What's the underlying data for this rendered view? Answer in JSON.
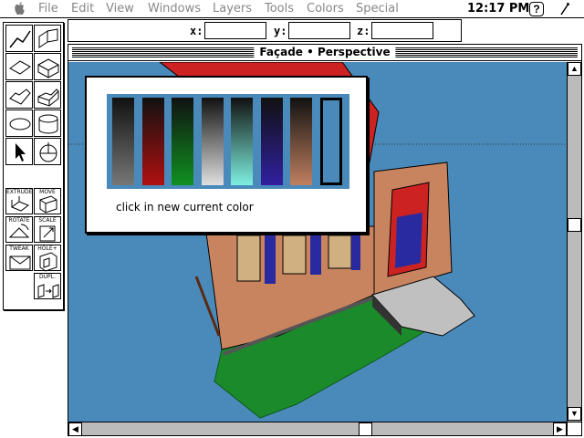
{
  "menubar": {
    "items": [
      "File",
      "Edit",
      "View",
      "Windows",
      "Layers",
      "Tools",
      "Colors",
      "Special"
    ],
    "clock": "12:17 PM",
    "help": "?"
  },
  "coordbar": {
    "x_label": "x:",
    "y_label": "y:",
    "z_label": "z:",
    "x_value": "",
    "y_value": "",
    "z_value": ""
  },
  "palette": {
    "labels": {
      "extrude": "EXTRUDE",
      "move": "MOVE",
      "rotate": "ROTATE",
      "scale": "SCALE",
      "tweak": "TWEAK",
      "hole": "HOLE+",
      "dupl": "DUPL."
    }
  },
  "window": {
    "title": "Façade • Perspective"
  },
  "dialog": {
    "message": "click in new current color",
    "swatches": [
      {
        "top": "#111111",
        "bottom": "#777777"
      },
      {
        "top": "#111111",
        "bottom": "#b01010"
      },
      {
        "top": "#111111",
        "bottom": "#109020"
      },
      {
        "top": "#111111",
        "bottom": "#e0e0e0"
      },
      {
        "top": "#111111",
        "bottom": "#7ef0e0"
      },
      {
        "top": "#111111",
        "bottom": "#3020a0"
      },
      {
        "top": "#111111",
        "bottom": "#c08060"
      },
      {
        "top": "#4a8abb",
        "bottom": "#4a8abb"
      }
    ],
    "selected_index": 7
  },
  "colors": {
    "sky": "#4a8abb",
    "wall": "#c8845e",
    "roof": "#cc2222",
    "grass": "#1a8a2a",
    "window": "#2a2aa0"
  }
}
